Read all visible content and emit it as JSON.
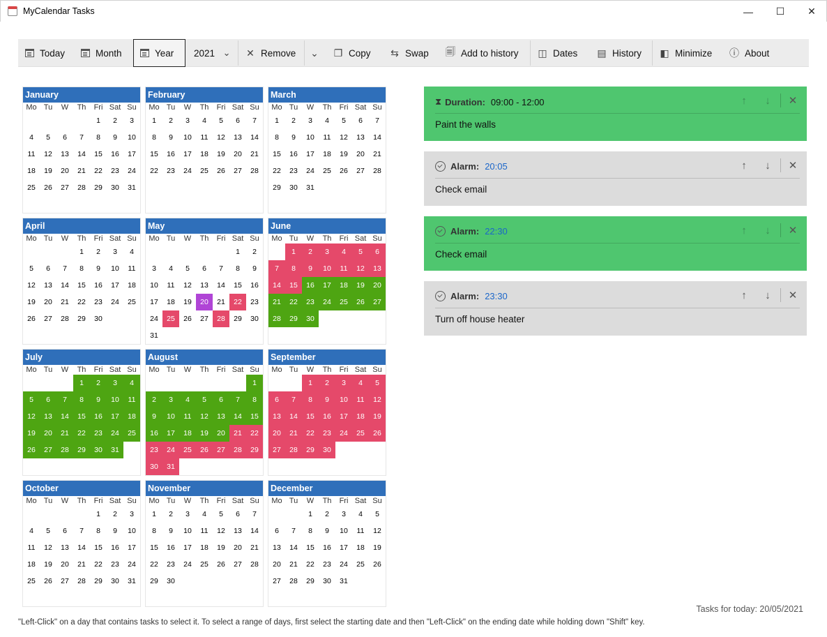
{
  "window": {
    "title": "MyCalendar Tasks"
  },
  "toolbar": {
    "today": "Today",
    "month": "Month",
    "year": "Year",
    "year_value": "2021",
    "remove": "Remove",
    "copy": "Copy",
    "swap": "Swap",
    "add_to_history": "Add to history",
    "dates": "Dates",
    "history": "History",
    "minimize": "Minimize",
    "about": "About"
  },
  "weekdays": [
    "Mo",
    "Tu",
    "W",
    "Th",
    "Fri",
    "Sat",
    "Su"
  ],
  "colors": {
    "red": "#e5496a",
    "green": "#4ea512",
    "purple": "#b045d6",
    "header": "#2f6fba"
  },
  "months": [
    {
      "name": "January",
      "offset": 4,
      "days": 31,
      "marks": {}
    },
    {
      "name": "February",
      "offset": 0,
      "days": 28,
      "marks": {}
    },
    {
      "name": "March",
      "offset": 0,
      "days": 31,
      "marks": {}
    },
    {
      "name": "April",
      "offset": 3,
      "days": 30,
      "marks": {}
    },
    {
      "name": "May",
      "offset": 5,
      "days": 31,
      "marks": {
        "20": "purple",
        "22": "red",
        "25": "red",
        "28": "red"
      }
    },
    {
      "name": "June",
      "offset": 1,
      "days": 30,
      "marks": {
        "1": "red",
        "2": "red",
        "3": "red",
        "4": "red",
        "5": "red",
        "6": "red",
        "7": "red",
        "8": "red",
        "9": "red",
        "10": "red",
        "11": "red",
        "12": "red",
        "13": "red",
        "14": "red",
        "15": "red",
        "16": "green",
        "17": "green",
        "18": "green",
        "19": "green",
        "20": "green",
        "21": "green",
        "22": "green",
        "23": "green",
        "24": "green",
        "25": "green",
        "26": "green",
        "27": "green",
        "28": "green",
        "29": "green",
        "30": "green"
      }
    },
    {
      "name": "July",
      "offset": 3,
      "days": 31,
      "marks": {
        "1": "green",
        "2": "green",
        "3": "green",
        "4": "green",
        "5": "green",
        "6": "green",
        "7": "green",
        "8": "green",
        "9": "green",
        "10": "green",
        "11": "green",
        "12": "green",
        "13": "green",
        "14": "green",
        "15": "green",
        "16": "green",
        "17": "green",
        "18": "green",
        "19": "green",
        "20": "green",
        "21": "green",
        "22": "green",
        "23": "green",
        "24": "green",
        "25": "green",
        "26": "green",
        "27": "green",
        "28": "green",
        "29": "green",
        "30": "green",
        "31": "green"
      }
    },
    {
      "name": "August",
      "offset": 6,
      "days": 31,
      "marks": {
        "1": "green",
        "2": "green",
        "3": "green",
        "4": "green",
        "5": "green",
        "6": "green",
        "7": "green",
        "8": "green",
        "9": "green",
        "10": "green",
        "11": "green",
        "12": "green",
        "13": "green",
        "14": "green",
        "15": "green",
        "16": "green",
        "17": "green",
        "18": "green",
        "19": "green",
        "20": "green",
        "21": "red",
        "22": "red",
        "23": "red",
        "24": "red",
        "25": "red",
        "26": "red",
        "27": "red",
        "28": "red",
        "29": "red",
        "30": "red",
        "31": "red"
      }
    },
    {
      "name": "September",
      "offset": 2,
      "days": 30,
      "marks": {
        "1": "red",
        "2": "red",
        "3": "red",
        "4": "red",
        "5": "red",
        "6": "red",
        "7": "red",
        "8": "red",
        "9": "red",
        "10": "red",
        "11": "red",
        "12": "red",
        "13": "red",
        "14": "red",
        "15": "red",
        "16": "red",
        "17": "red",
        "18": "red",
        "19": "red",
        "20": "red",
        "21": "red",
        "22": "red",
        "23": "red",
        "24": "red",
        "25": "red",
        "26": "red",
        "27": "red",
        "28": "red",
        "29": "red",
        "30": "red"
      }
    },
    {
      "name": "October",
      "offset": 4,
      "days": 31,
      "marks": {}
    },
    {
      "name": "November",
      "offset": 0,
      "days": 30,
      "marks": {}
    },
    {
      "name": "December",
      "offset": 2,
      "days": 31,
      "marks": {}
    }
  ],
  "tasks": [
    {
      "kind": "Duration:",
      "time": "09:00 - 12:00",
      "text": "Paint the walls",
      "style": "green",
      "icon": "hourglass-icon"
    },
    {
      "kind": "Alarm:",
      "time": "20:05",
      "text": "Check email",
      "style": "gray",
      "icon": "alarm-icon"
    },
    {
      "kind": "Alarm:",
      "time": "22:30",
      "text": "Check email",
      "style": "green",
      "icon": "alarm-icon"
    },
    {
      "kind": "Alarm:",
      "time": "23:30",
      "text": "Turn off house heater",
      "style": "gray",
      "icon": "alarm-icon"
    }
  ],
  "status": "Tasks for today: 20/05/2021",
  "footer": "\"Left-Click\" on a day that contains tasks to select it. To select a range of days, first select the starting date and then \"Left-Click\" on the ending date while holding down \"Shift\" key."
}
